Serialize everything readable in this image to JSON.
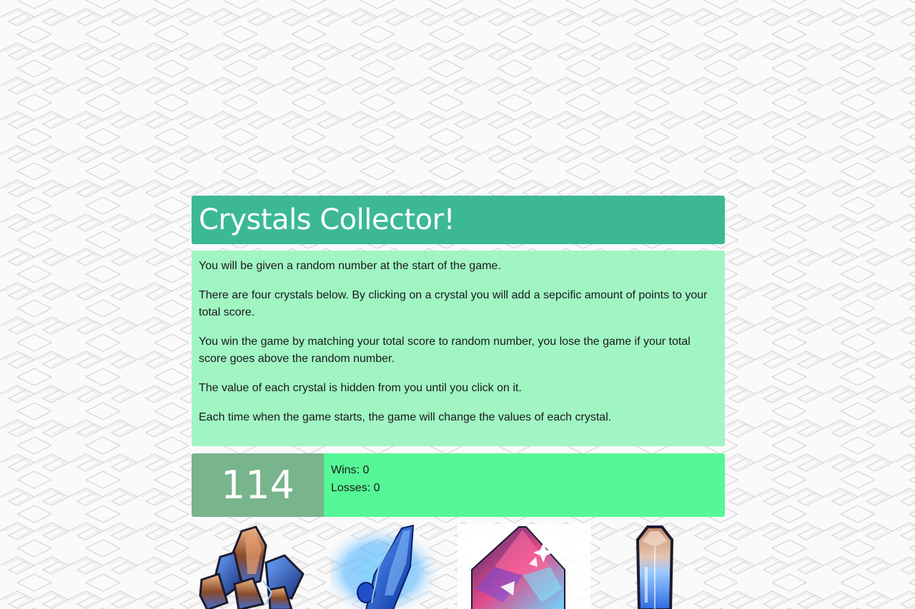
{
  "header": {
    "title": "Crystals Collector!"
  },
  "rules": [
    "You will be given a random number at the start of the game.",
    "There are four crystals below. By clicking on a crystal you will add a sepcific amount of points to your total score.",
    "You win the game by matching your total score to random number, you lose the game if your total score goes above the random number.",
    "The value of each crystal is hidden from you until you click on it.",
    "Each time when the game starts, the game will change the values of each crystal."
  ],
  "scoreboard": {
    "target_number": "114",
    "wins_label": "Wins: 0",
    "losses_label": "Losses: 0"
  },
  "crystals": [
    {
      "name": "crystal-cluster-orange-blue-icon"
    },
    {
      "name": "crystal-blue-glowing-icon"
    },
    {
      "name": "crystal-diamond-pink-icon"
    },
    {
      "name": "crystal-shard-blue-icon"
    }
  ],
  "colors": {
    "title_bg": "#3cb994",
    "rules_bg": "#a0f5c3",
    "target_bg": "#78b48c",
    "stats_bg": "#55f797"
  }
}
